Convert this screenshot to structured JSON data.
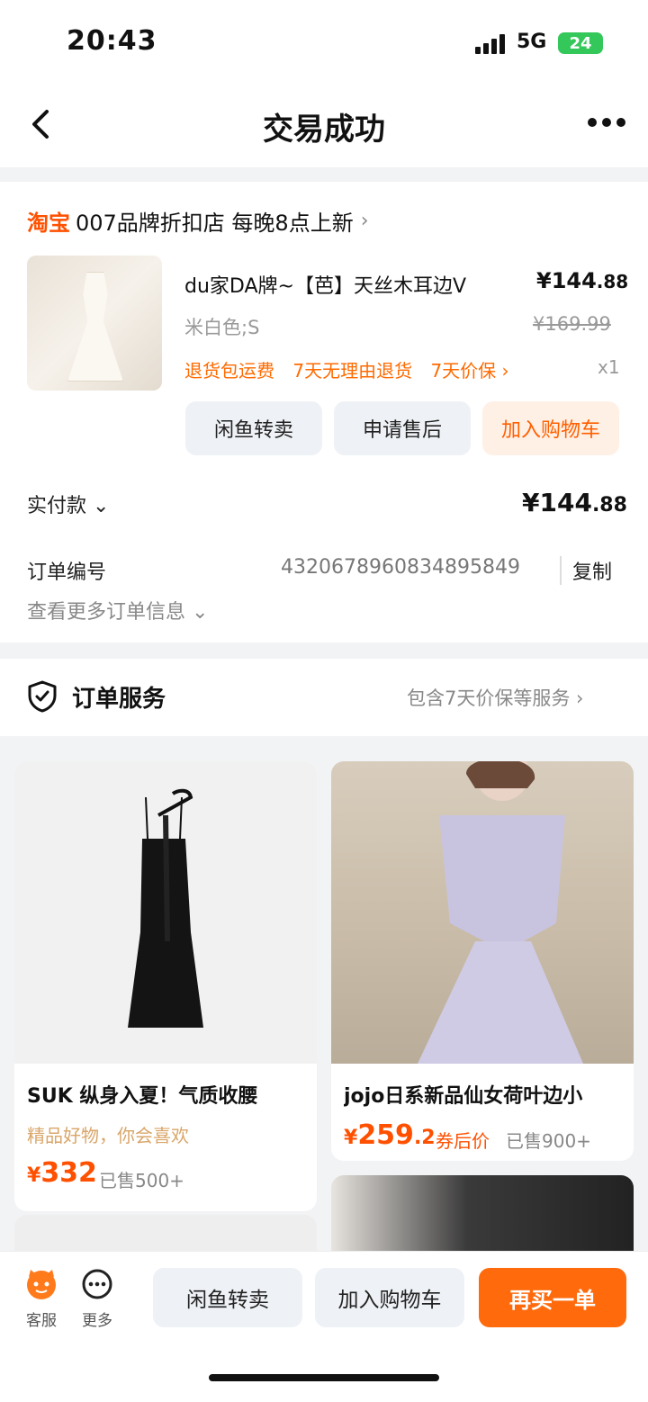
{
  "status": {
    "time": "20:43",
    "network": "5G",
    "battery": "24"
  },
  "nav": {
    "title": "交易成功"
  },
  "order": {
    "shop_logo": "淘宝",
    "shop_name": "007品牌折扣店 每晚8点上新",
    "product_title": "du家DA牌~【芭】天丝木耳边V",
    "price_int": "¥144",
    "price_dec": ".88",
    "spec": "米白色;S",
    "original_price": "¥169.99",
    "tags": [
      "退货包运费",
      "7天无理由退货",
      "7天价保 ›"
    ],
    "qty": "x1",
    "buttons": {
      "resell": "闲鱼转卖",
      "after_sale": "申请售后",
      "add_cart": "加入购物车"
    },
    "paid_label": "实付款 ⌄",
    "paid_int": "¥144",
    "paid_dec": ".88",
    "order_no_label": "订单编号",
    "order_no": "4320678960834895849",
    "copy": "复制",
    "more_info": "查看更多订单信息 ⌄"
  },
  "service": {
    "title": "订单服务",
    "summary": "包含7天价保等服务 ›"
  },
  "feed": [
    {
      "title": "SUK 纵身入夏！气质收腰",
      "subtitle": "精品好物，你会喜欢",
      "price_int": "332",
      "price_dec": "",
      "sold": "已售500+"
    },
    {
      "title": "jojo日系新品仙女荷叶边小",
      "price_int": "259",
      "price_dec": ".2",
      "coupon": "券后价",
      "sold": "已售900+"
    }
  ],
  "bottom": {
    "service_label": "客服",
    "more_label": "更多",
    "resell": "闲鱼转卖",
    "add_cart": "加入购物车",
    "rebuy": "再买一单"
  },
  "colors": {
    "accent": "#ff5000",
    "button_orange": "#ff6a0c"
  }
}
